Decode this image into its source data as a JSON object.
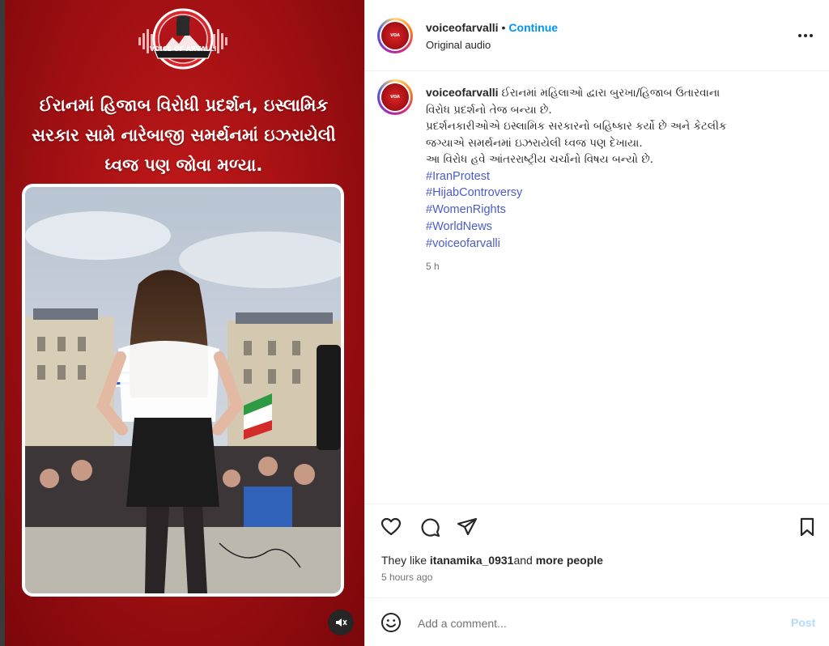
{
  "media": {
    "logo_text": "VOICE OF ARVALLI",
    "headline_lines": [
      "ઈરાનમાં હિજાબ વિરોધી પ્રદર્શન, ઇસ્લામિક",
      "સરકાર સામે નારેબાજી સમર્થનમાં ઇઝરાયેલી",
      "ધ્વજ પણ જોવા મળ્યા."
    ],
    "mute_icon": "speaker-muted-icon",
    "accent_color": "#b3141a"
  },
  "header": {
    "username": "voiceofarvalli",
    "separator": "•",
    "continue_label": "Continue",
    "audio": "Original audio",
    "more_icon": "more-horizontal-icon"
  },
  "caption": {
    "username": "voiceofarvalli",
    "lines": [
      "ઈરાનમાં મહિલાઓ દ્વારા બુરખા/હિજાબ ઉતારવાના",
      "વિરોધ પ્રદર્શનો તેજ બન્યા છે.",
      "પ્રદર્શનકારીઓએ ઇસ્લામિક સરકારનો બહિષ્કાર કર્યો છે અને કેટલીક",
      "જગ્યાએ સમર્થનમાં ઇઝરાયેલી ધ્વજ પણ દેખાયા.",
      "આ વિરોધ હવે આંતરરાષ્ટ્રીય ચર્ચાનો વિષય બન્યો છે."
    ],
    "hashtags": [
      "#IranProtest",
      "#HijabControversy",
      "#WomenRights",
      "#WorldNews",
      "#voiceofarvalli"
    ],
    "age": "5 h"
  },
  "actions": {
    "like_icon": "heart-icon",
    "comment_icon": "comment-icon",
    "share_icon": "share-icon",
    "save_icon": "bookmark-icon"
  },
  "likes": {
    "prefix": "They like ",
    "user": "itanamika_0931",
    "connector": "and",
    "suffix": " more people"
  },
  "post_time": "5 hours ago",
  "comment": {
    "emoji_icon": "emoji-icon",
    "placeholder": "Add a comment...",
    "post_label": "Post"
  }
}
